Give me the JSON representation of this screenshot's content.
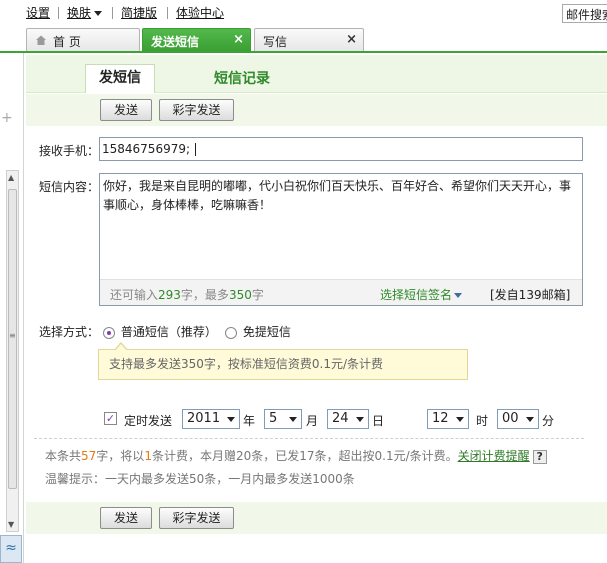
{
  "topmenu": {
    "settings": "设置",
    "skin": "换肤",
    "simple": "简捷版",
    "experience": "体验中心",
    "mail_search": "邮件搜索"
  },
  "tabs": [
    {
      "label": "首 页",
      "icon": "home-icon"
    },
    {
      "label": "发送短信",
      "close": "×",
      "active": true
    },
    {
      "label": "写信",
      "close": "×"
    }
  ],
  "subtabs": {
    "active": "发短信",
    "records": "短信记录"
  },
  "toolbar": {
    "send": "发送",
    "color_send": "彩字发送"
  },
  "form": {
    "recipient_label": "接收手机：",
    "recipient_value": "15846756979;",
    "content_label": "短信内容：",
    "content_value": "你好，我是来自昆明的嘟嘟，代小白祝你们百天快乐、百年好合、希望你们天天开心，事事顺心，身体棒棒，吃嘛嘛香！",
    "count_prefix": "还可输入",
    "count_remaining": "293",
    "count_mid": "字，最多",
    "count_max": "350",
    "count_suffix": "字",
    "signature": "选择短信签名",
    "from": "[发自139邮箱]",
    "method_label": "选择方式：",
    "method_normal": "普通短信（推荐）",
    "method_free": "免提短信",
    "tip": "支持最多发送350字，按标准短信资费0.1元/条计费"
  },
  "schedule": {
    "checkbox_mark": "✓",
    "label": "定时发送",
    "year": "2011",
    "year_unit": "年",
    "month": "5",
    "month_unit": "月",
    "day": "24",
    "day_unit": "日",
    "hour": "12",
    "hour_unit": "时",
    "minute": "00",
    "minute_unit": "分"
  },
  "info": {
    "p1": "本条共",
    "chars": "57",
    "p2": "字，将以",
    "msgs": "1",
    "p3": "条计费，本月赠20条，已发17条，超出按0.1元/条计费。",
    "link": "关闭计费提醒",
    "help": "?",
    "warm": "温馨提示：一天内最多发送50条，一月内最多发送1000条"
  },
  "sidebar": {
    "plus": "+",
    "collapse": "≈"
  },
  "colors": {
    "green": "#3aa535",
    "link_green": "#2e8a28",
    "highlight": "#e47a14"
  }
}
